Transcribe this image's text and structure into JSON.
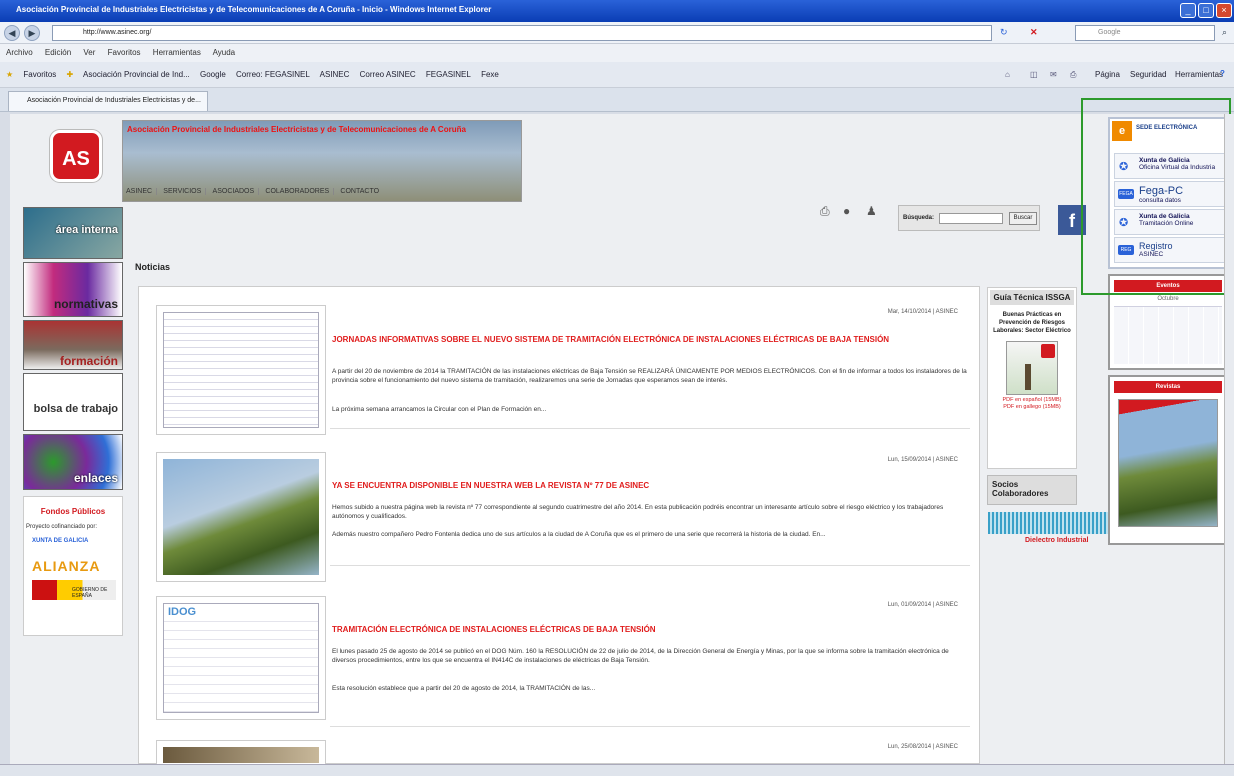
{
  "window": {
    "title": "Asociación Provincial de Industriales Electricistas y de Telecomunicaciones de A Coruña - Inicio - Windows Internet Explorer"
  },
  "addressbar": {
    "url": "http://www.asinec.org/",
    "search_placeholder": "Google"
  },
  "menubar": [
    "Archivo",
    "Edición",
    "Ver",
    "Favoritos",
    "Herramientas",
    "Ayuda"
  ],
  "favorites": {
    "label": "Favoritos",
    "items": [
      "Asociación Provincial de Ind...",
      "Google",
      "Correo: FEGASINEL",
      "ASINEC",
      "Correo ASINEC",
      "FEGASINEL",
      "Fexe"
    ]
  },
  "toolbar_right": [
    "Página",
    "Seguridad",
    "Herramientas"
  ],
  "tab": {
    "label": "Asociación Provincial de Industriales Electricistas y de..."
  },
  "site": {
    "logo": "AS",
    "banner_title": "Asociación Provincial de Industriales Electricistas y de Telecomunicaciones de A Coruña",
    "nav": [
      "ASINEC",
      "SERVICIOS",
      "ASOCIADOS",
      "COLABORADORES",
      "CONTACTO"
    ],
    "search_label": "Búsqueda:",
    "search_button": "Buscar",
    "section_title": "Noticias"
  },
  "sidebar": {
    "tiles": [
      "área interna",
      "normativas",
      "formación",
      "bolsa de trabajo",
      "enlaces"
    ],
    "fondos_title": "Fondos Públicos",
    "fondos_sub": "Proyecto cofinanciado por:",
    "fondos_logos": [
      "XUNTA DE GALICIA",
      "ALIANZA",
      "GOBIERNO DE ESPAÑA"
    ]
  },
  "articles": [
    {
      "date": "Mar, 14/10/2014 | ASINEC",
      "title": "JORNADAS INFORMATIVAS SOBRE EL NUEVO SISTEMA DE TRAMITACIÓN ELECTRÓNICA DE INSTALACIONES ELÉCTRICAS DE BAJA TENSIÓN",
      "text": "A partir del 20 de noviembre de 2014 la TRAMITACIÓN de las instalaciones eléctricas de Baja Tensión se REALIZARÁ ÚNICAMENTE POR MEDIOS ELECTRÓNICOS. Con el fin de informar a todos los instaladores de la provincia sobre el funcionamiento del nuevo sistema de tramitación, realizaremos una serie de Jornadas que esperamos sean de interés.",
      "text2": "La próxima semana arrancamos la Circular con el Plan de Formación en..."
    },
    {
      "date": "Lun, 15/09/2014 | ASINEC",
      "title": "YA SE ENCUENTRA DISPONIBLE EN NUESTRA WEB LA REVISTA Nº 77 DE ASINEC",
      "text": "Hemos subido a nuestra página web la revista nº 77 correspondiente al segundo cuatrimestre del año 2014. En esta publicación podréis encontrar un interesante artículo sobre el riesgo eléctrico y los trabajadores autónomos y cualificados.",
      "text2": "Además nuestro compañero Pedro Fontenla dedica uno de sus artículos a la ciudad de A Coruña que es el primero de una serie que recorrerá la historia de la ciudad. En..."
    },
    {
      "date": "Lun, 01/09/2014 | ASINEC",
      "title": "TRAMITACIÓN ELECTRÓNICA DE INSTALACIONES ELÉCTRICAS DE BAJA TENSIÓN",
      "text": "El lunes pasado 25 de agosto de 2014 se publicó en el DOG Núm. 160 la RESOLUCIÓN de 22 de julio de 2014, de la Dirección General de Energía y Minas, por la que se informa sobre la tramitación electrónica de diversos procedimientos, entre los que se encuentra el IN414C de instalaciones de eléctricas de Baja Tensión.",
      "text2": "Esta resolución establece que a partir del 20 de agosto de 2014, la TRAMITACIÓN de las...",
      "image_header": "IDOG"
    },
    {
      "date": "Lun, 25/08/2014 | ASINEC"
    }
  ],
  "guia": {
    "title": "Guía Técnica ISSGA",
    "subtitle": "Buenas Prácticas en Prevención de Riesgos Laborales: Sector Eléctrico",
    "link1": "PDF en español (15MB)",
    "link2": "PDF en gallego (15MB)"
  },
  "socios": {
    "title": "Socios Colaboradores",
    "partner": "Dielectro Industrial"
  },
  "sede": {
    "header": "SEDE ELECTRÓNICA",
    "items": [
      {
        "title": "Xunta de Galicia",
        "sub": "Oficina Virtual da Industria"
      },
      {
        "title": "Fega-PC",
        "sub": "consulta datos"
      },
      {
        "title": "Xunta de Galicia",
        "sub": "Tramitación Online"
      },
      {
        "title": "Registro",
        "sub": "ASINEC"
      }
    ]
  },
  "calendar": {
    "header": "Eventos",
    "month": "Octubre"
  },
  "revista": {
    "header": "Revistas"
  },
  "colors": {
    "accent": "#d21a20",
    "title_blue": "#0a3db4",
    "highlight_green": "#2c9a2c"
  }
}
